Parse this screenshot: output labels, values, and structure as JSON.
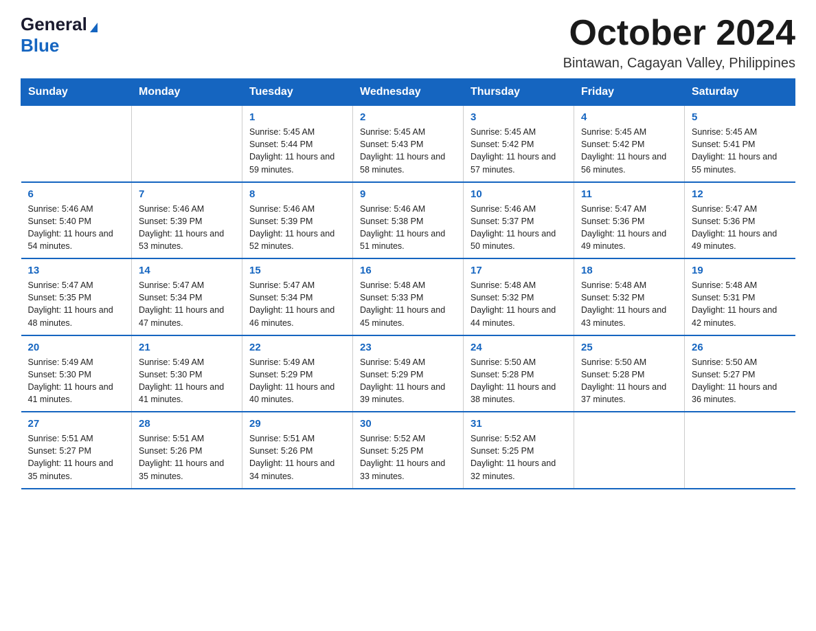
{
  "logo": {
    "general": "General",
    "blue": "Blue",
    "triangle_color": "#1565c0"
  },
  "title": "October 2024",
  "subtitle": "Bintawan, Cagayan Valley, Philippines",
  "header_color": "#1565c0",
  "days_of_week": [
    "Sunday",
    "Monday",
    "Tuesday",
    "Wednesday",
    "Thursday",
    "Friday",
    "Saturday"
  ],
  "weeks": [
    [
      {
        "day": "",
        "sunrise": "",
        "sunset": "",
        "daylight": ""
      },
      {
        "day": "",
        "sunrise": "",
        "sunset": "",
        "daylight": ""
      },
      {
        "day": "1",
        "sunrise": "5:45 AM",
        "sunset": "5:44 PM",
        "daylight": "11 hours and 59 minutes."
      },
      {
        "day": "2",
        "sunrise": "5:45 AM",
        "sunset": "5:43 PM",
        "daylight": "11 hours and 58 minutes."
      },
      {
        "day": "3",
        "sunrise": "5:45 AM",
        "sunset": "5:42 PM",
        "daylight": "11 hours and 57 minutes."
      },
      {
        "day": "4",
        "sunrise": "5:45 AM",
        "sunset": "5:42 PM",
        "daylight": "11 hours and 56 minutes."
      },
      {
        "day": "5",
        "sunrise": "5:45 AM",
        "sunset": "5:41 PM",
        "daylight": "11 hours and 55 minutes."
      }
    ],
    [
      {
        "day": "6",
        "sunrise": "5:46 AM",
        "sunset": "5:40 PM",
        "daylight": "11 hours and 54 minutes."
      },
      {
        "day": "7",
        "sunrise": "5:46 AM",
        "sunset": "5:39 PM",
        "daylight": "11 hours and 53 minutes."
      },
      {
        "day": "8",
        "sunrise": "5:46 AM",
        "sunset": "5:39 PM",
        "daylight": "11 hours and 52 minutes."
      },
      {
        "day": "9",
        "sunrise": "5:46 AM",
        "sunset": "5:38 PM",
        "daylight": "11 hours and 51 minutes."
      },
      {
        "day": "10",
        "sunrise": "5:46 AM",
        "sunset": "5:37 PM",
        "daylight": "11 hours and 50 minutes."
      },
      {
        "day": "11",
        "sunrise": "5:47 AM",
        "sunset": "5:36 PM",
        "daylight": "11 hours and 49 minutes."
      },
      {
        "day": "12",
        "sunrise": "5:47 AM",
        "sunset": "5:36 PM",
        "daylight": "11 hours and 49 minutes."
      }
    ],
    [
      {
        "day": "13",
        "sunrise": "5:47 AM",
        "sunset": "5:35 PM",
        "daylight": "11 hours and 48 minutes."
      },
      {
        "day": "14",
        "sunrise": "5:47 AM",
        "sunset": "5:34 PM",
        "daylight": "11 hours and 47 minutes."
      },
      {
        "day": "15",
        "sunrise": "5:47 AM",
        "sunset": "5:34 PM",
        "daylight": "11 hours and 46 minutes."
      },
      {
        "day": "16",
        "sunrise": "5:48 AM",
        "sunset": "5:33 PM",
        "daylight": "11 hours and 45 minutes."
      },
      {
        "day": "17",
        "sunrise": "5:48 AM",
        "sunset": "5:32 PM",
        "daylight": "11 hours and 44 minutes."
      },
      {
        "day": "18",
        "sunrise": "5:48 AM",
        "sunset": "5:32 PM",
        "daylight": "11 hours and 43 minutes."
      },
      {
        "day": "19",
        "sunrise": "5:48 AM",
        "sunset": "5:31 PM",
        "daylight": "11 hours and 42 minutes."
      }
    ],
    [
      {
        "day": "20",
        "sunrise": "5:49 AM",
        "sunset": "5:30 PM",
        "daylight": "11 hours and 41 minutes."
      },
      {
        "day": "21",
        "sunrise": "5:49 AM",
        "sunset": "5:30 PM",
        "daylight": "11 hours and 41 minutes."
      },
      {
        "day": "22",
        "sunrise": "5:49 AM",
        "sunset": "5:29 PM",
        "daylight": "11 hours and 40 minutes."
      },
      {
        "day": "23",
        "sunrise": "5:49 AM",
        "sunset": "5:29 PM",
        "daylight": "11 hours and 39 minutes."
      },
      {
        "day": "24",
        "sunrise": "5:50 AM",
        "sunset": "5:28 PM",
        "daylight": "11 hours and 38 minutes."
      },
      {
        "day": "25",
        "sunrise": "5:50 AM",
        "sunset": "5:28 PM",
        "daylight": "11 hours and 37 minutes."
      },
      {
        "day": "26",
        "sunrise": "5:50 AM",
        "sunset": "5:27 PM",
        "daylight": "11 hours and 36 minutes."
      }
    ],
    [
      {
        "day": "27",
        "sunrise": "5:51 AM",
        "sunset": "5:27 PM",
        "daylight": "11 hours and 35 minutes."
      },
      {
        "day": "28",
        "sunrise": "5:51 AM",
        "sunset": "5:26 PM",
        "daylight": "11 hours and 35 minutes."
      },
      {
        "day": "29",
        "sunrise": "5:51 AM",
        "sunset": "5:26 PM",
        "daylight": "11 hours and 34 minutes."
      },
      {
        "day": "30",
        "sunrise": "5:52 AM",
        "sunset": "5:25 PM",
        "daylight": "11 hours and 33 minutes."
      },
      {
        "day": "31",
        "sunrise": "5:52 AM",
        "sunset": "5:25 PM",
        "daylight": "11 hours and 32 minutes."
      },
      {
        "day": "",
        "sunrise": "",
        "sunset": "",
        "daylight": ""
      },
      {
        "day": "",
        "sunrise": "",
        "sunset": "",
        "daylight": ""
      }
    ]
  ]
}
